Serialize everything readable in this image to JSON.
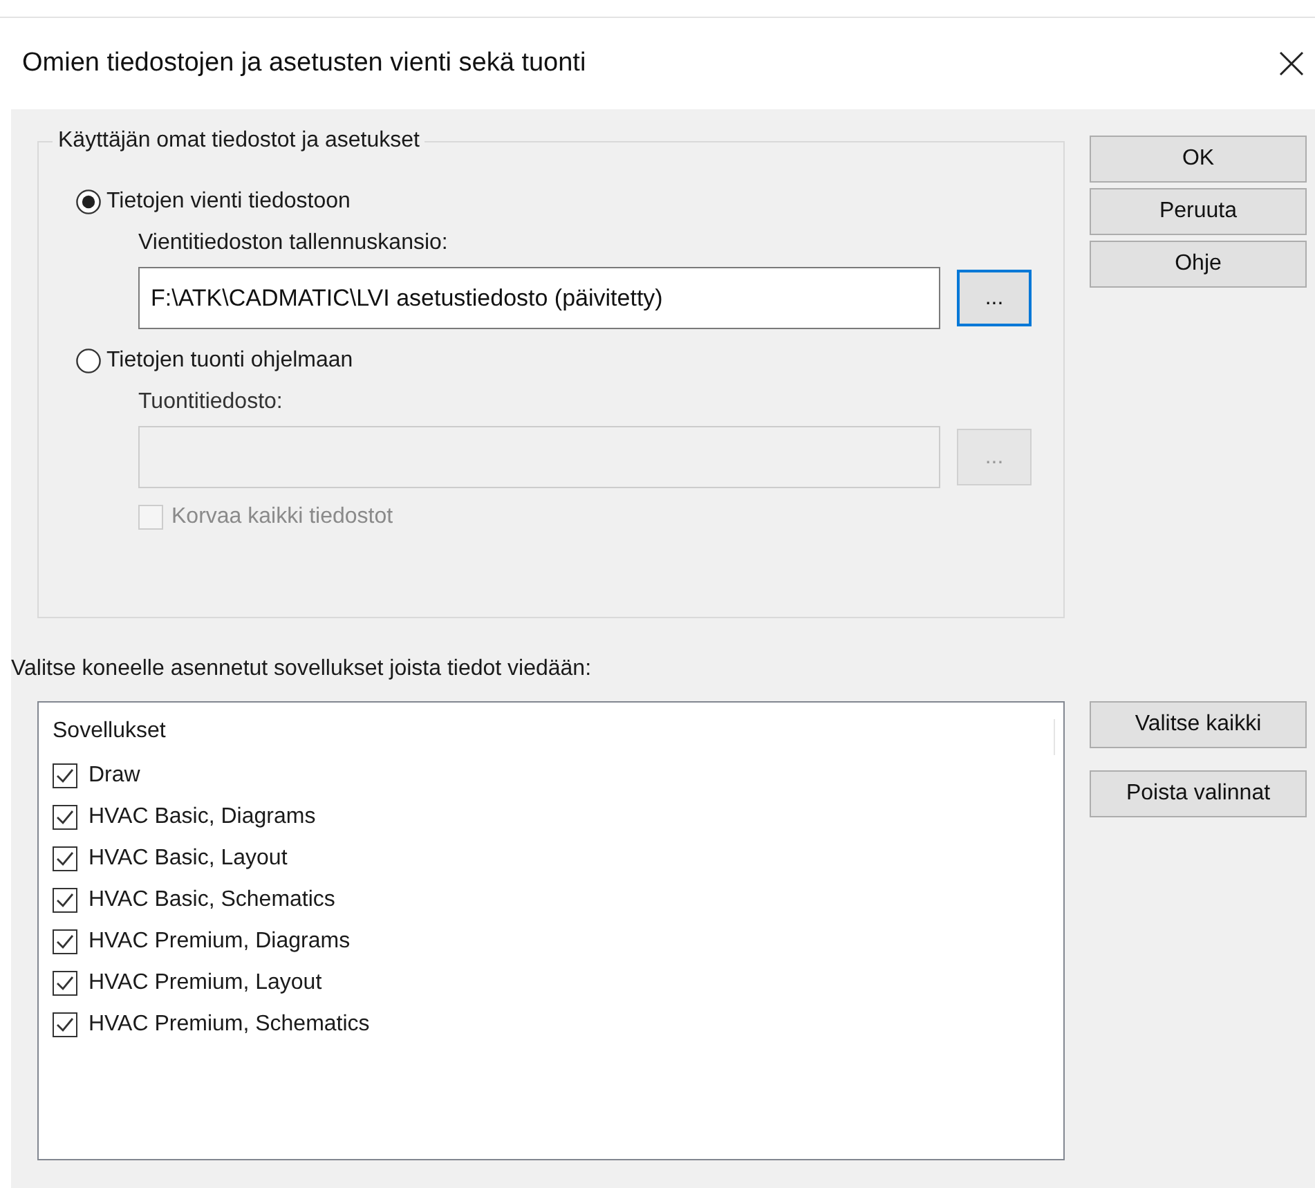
{
  "window": {
    "title": "Omien tiedostojen ja asetusten vienti sekä tuonti"
  },
  "group": {
    "legend": "Käyttäjän omat tiedostot ja asetukset",
    "options": [
      {
        "label": "Tietojen vienti tiedostoon",
        "selected": true,
        "field": {
          "label": "Vientitiedoston tallennuskansio:",
          "value": "F:\\ATK\\CADMATIC\\LVI asetustiedosto (päivitetty)"
        },
        "browse": "...",
        "disabled": false,
        "focused": true
      },
      {
        "label": "Tietojen tuonti ohjelmaan",
        "selected": false,
        "field": {
          "label": "Tuontitiedosto:"
        },
        "browse": "...",
        "disabled": true,
        "focused": false,
        "checkbox": {
          "label": "Korvaa kaikki tiedostot",
          "checked": false,
          "disabled": true
        }
      }
    ]
  },
  "buttons": [
    "OK",
    "Peruuta",
    "Ohje"
  ],
  "apps": {
    "prompt": "Valitse koneelle asennetut sovellukset joista tiedot viedään:",
    "column": "Sovellukset",
    "items": [
      {
        "label": "Draw",
        "checked": true
      },
      {
        "label": "HVAC Basic, Diagrams",
        "checked": true
      },
      {
        "label": "HVAC Basic, Layout",
        "checked": true
      },
      {
        "label": "HVAC Basic, Schematics",
        "checked": true
      },
      {
        "label": "HVAC Premium, Diagrams",
        "checked": true
      },
      {
        "label": "HVAC Premium, Layout",
        "checked": true
      },
      {
        "label": "HVAC Premium, Schematics",
        "checked": true
      }
    ],
    "buttons": [
      "Valitse kaikki",
      "Poista valinnat"
    ]
  }
}
